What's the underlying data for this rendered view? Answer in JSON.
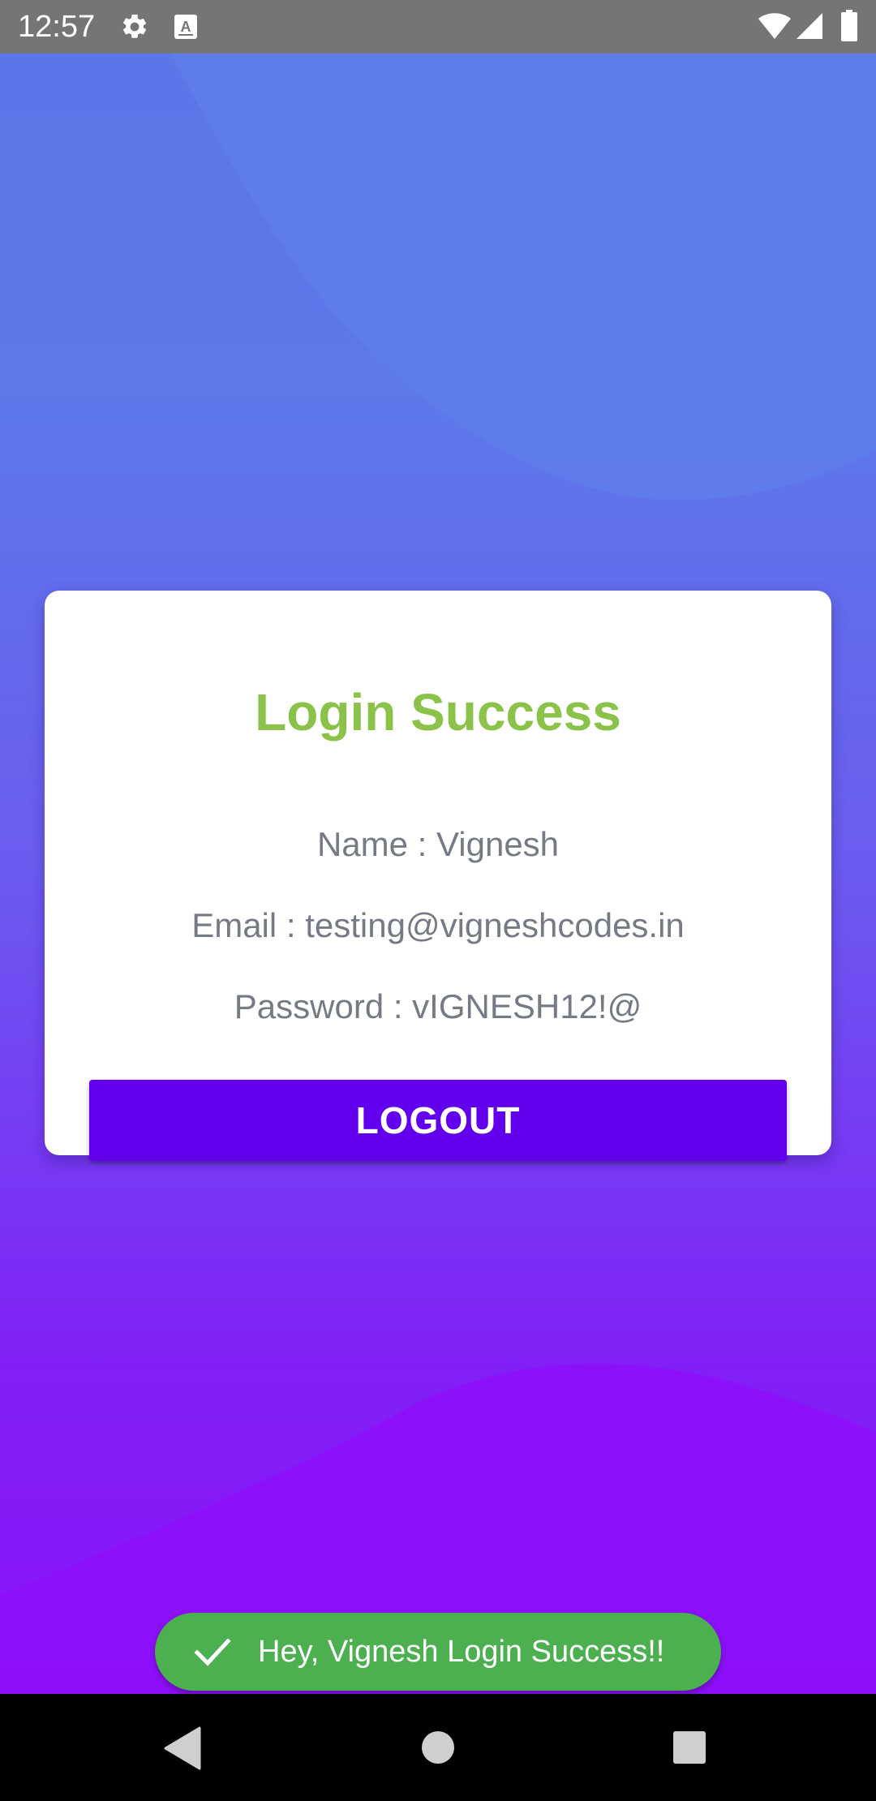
{
  "status_bar": {
    "time": "12:57",
    "icons": [
      "settings-icon",
      "a-notification-icon",
      "wifi-icon",
      "signal-icon",
      "battery-icon"
    ]
  },
  "card": {
    "title": "Login Success",
    "name_line": "Name : Vignesh",
    "email_line": "Email : testing@vigneshcodes.in",
    "password_line": "Password : vIGNESH12!@",
    "logout_label": "LOGOUT"
  },
  "toast": {
    "message": "Hey, Vignesh Login Success!!",
    "icon": "check-icon"
  },
  "nav_bar": {
    "icons": [
      "back-icon",
      "home-icon",
      "recents-icon"
    ]
  },
  "colors": {
    "title_green": "#8bc34a",
    "button_purple": "#6200ee",
    "toast_green": "#4caf50",
    "status_bar_gray": "#757575",
    "info_text_gray": "#757a85",
    "gradient_top": "#5b73e6",
    "gradient_bottom": "#8b12f8"
  }
}
